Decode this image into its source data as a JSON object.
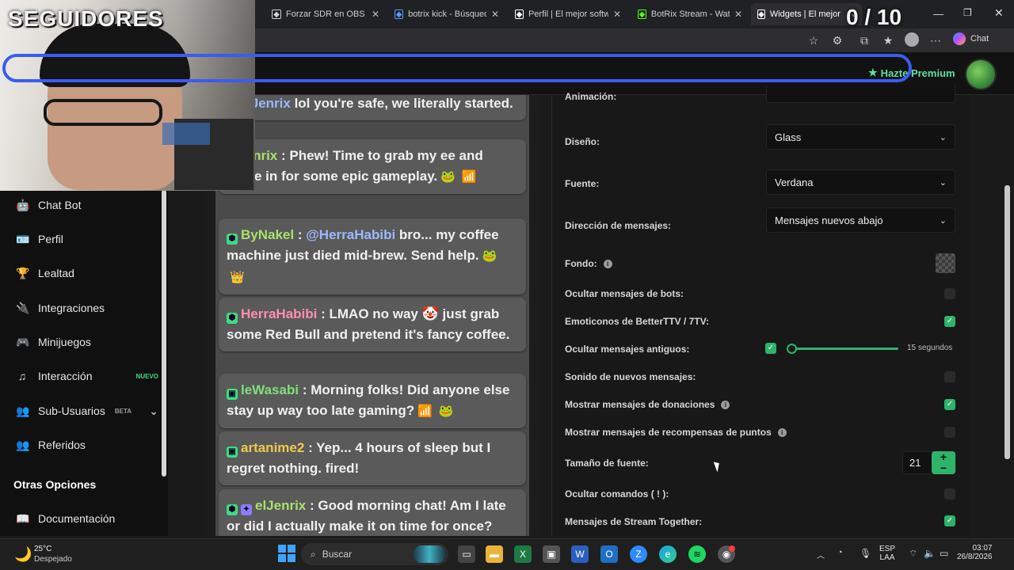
{
  "browser": {
    "tabs": [
      {
        "label": "Forzar SDR en OBS",
        "icon": "obs-icon",
        "color": "#cfcfcf"
      },
      {
        "label": "botrix kick - Búsqueda",
        "icon": "search-icon",
        "color": "#5b9cff"
      },
      {
        "label": "Perfil | El mejor softwar",
        "icon": "botrix-icon",
        "color": "#ffffff"
      },
      {
        "label": "BotRix Stream - Watch",
        "icon": "kick-icon",
        "color": "#53fc18"
      },
      {
        "label": "Widgets | El mejor softw",
        "icon": "botrix-icon",
        "color": "#ffffff"
      }
    ],
    "chat_button": "Chat"
  },
  "header": {
    "premium_label": "Hazte Premium",
    "premium_icon": "star-icon",
    "accent": "#5fe0a0"
  },
  "overlay": {
    "title": "SEGUIDORES",
    "count": "0 / 10",
    "count_current": 0,
    "count_goal": 10,
    "bar_color": "#3a5cf0"
  },
  "sidebar": {
    "items": [
      {
        "label": "Chat Bot",
        "icon": "robot-icon",
        "glyph": "🤖"
      },
      {
        "label": "Perfil",
        "icon": "id-card-icon",
        "glyph": "🪪"
      },
      {
        "label": "Lealtad",
        "icon": "trophy-icon",
        "glyph": "🏆"
      },
      {
        "label": "Integraciones",
        "icon": "plug-icon",
        "glyph": "🔌"
      },
      {
        "label": "Minijuegos",
        "icon": "gamepad-icon",
        "glyph": "🎮"
      },
      {
        "label": "Interacción",
        "icon": "music-icon",
        "glyph": "♫",
        "badge": "NUEVO",
        "badge_color": "#3ddc84"
      },
      {
        "label": "Sub-Usuarios",
        "icon": "users-cog-icon",
        "glyph": "👥",
        "badge": "BETA",
        "badge_color": "#9a9a9a",
        "chevron": "⌄"
      },
      {
        "label": "Referidos",
        "icon": "users-icon",
        "glyph": "👥"
      }
    ],
    "section_title": "Otras Opciones",
    "extra_items": [
      {
        "label": "Documentación",
        "icon": "book-icon",
        "glyph": "📖"
      }
    ]
  },
  "chat": {
    "messages": [
      {
        "badges": [],
        "user": "",
        "user_color": "#a8e06a",
        "mention": "@elJenrix",
        "text": " lol you're safe, we literally started.",
        "emotes": []
      },
      {
        "badges": [],
        "user": "elJenrix",
        "user_color": "#a8e06a",
        "mention": "",
        "text": ": Phew! Time to grab my ee and settle in for some epic gameplay.",
        "emotes": [
          "🐸",
          "📶"
        ]
      },
      {
        "badges": [
          {
            "glyph": "⬢",
            "color": "#3ddc84"
          }
        ],
        "user": "ByNakel",
        "user_color": "#a8e06a",
        "mention": "@HerraHabibi",
        "text": " bro... my coffee machine just died mid-brew. Send help.",
        "emotes": [
          "🐸",
          "👑"
        ]
      },
      {
        "badges": [
          {
            "glyph": "⬢",
            "color": "#3ddc84"
          }
        ],
        "user": "HerraHabibi",
        "user_color": "#ff8fb0",
        "mention": "",
        "text": ": LMAO no way 🤡 just grab some Red Bull and pretend it's fancy coffee.",
        "emotes": []
      },
      {
        "badges": [
          {
            "glyph": "▣",
            "color": "#3ddc84"
          }
        ],
        "user": "leWasabi",
        "user_color": "#7fe07a",
        "mention": "",
        "text": ": Morning folks! Did anyone else stay up way too late gaming?",
        "emotes": [
          "📶",
          "🐸"
        ]
      },
      {
        "badges": [
          {
            "glyph": "▣",
            "color": "#3ddc84"
          }
        ],
        "user": "artanime2",
        "user_color": "#f2c94c",
        "mention": "",
        "text": ": Yep... 4 hours of sleep but I regret nothing. fired!",
        "emotes": []
      },
      {
        "badges": [
          {
            "glyph": "⬢",
            "color": "#3ddc84"
          },
          {
            "glyph": "✦",
            "color": "#8a7cff"
          }
        ],
        "user": "elJenrix",
        "user_color": "#a8e06a",
        "mention": "",
        "text": ": Good morning chat! Am I late or did I actually make it on time for once?",
        "emotes": []
      }
    ]
  },
  "settings": {
    "animacion_label": "Animación:",
    "diseno_label": "Diseño:",
    "diseno_value": "Glass",
    "fuente_label": "Fuente:",
    "fuente_value": "Verdana",
    "direccion_label": "Dirección de mensajes:",
    "direccion_value": "Mensajes nuevos abajo",
    "fondo_label": "Fondo:",
    "rows": [
      {
        "label": "Ocultar mensajes de bots:",
        "checked": false,
        "info": false
      },
      {
        "label": "Emoticonos de BetterTTV / 7TV:",
        "checked": true,
        "info": false
      },
      {
        "label": "Sonido de nuevos mensajes:",
        "checked": false,
        "info": false
      },
      {
        "label": "Mostrar mensajes de donaciones",
        "checked": true,
        "info": true
      },
      {
        "label": "Mostrar mensajes de recompensas de puntos",
        "checked": false,
        "info": true
      }
    ],
    "ocultar_antiguos_label": "Ocultar mensajes antiguos:",
    "ocultar_antiguos_checked": true,
    "ocultar_antiguos_value": "15 segundos",
    "ocultar_antiguos_fraction": 0.0,
    "tamano_label": "Tamaño de fuente:",
    "tamano_value": "21",
    "comandos_label": "Ocultar comandos ( ! ):",
    "comandos_checked": false,
    "stream_together_label": "Mensajes de Stream Together:",
    "stream_together_checked": true,
    "accent": "#2fb36b"
  },
  "taskbar": {
    "weather_temp": "25°C",
    "weather_desc": "Despejado",
    "search_placeholder": "Buscar",
    "lang_line1": "ESP",
    "lang_line2": "LAA",
    "time": "03:07",
    "date": "26/8/2026"
  }
}
